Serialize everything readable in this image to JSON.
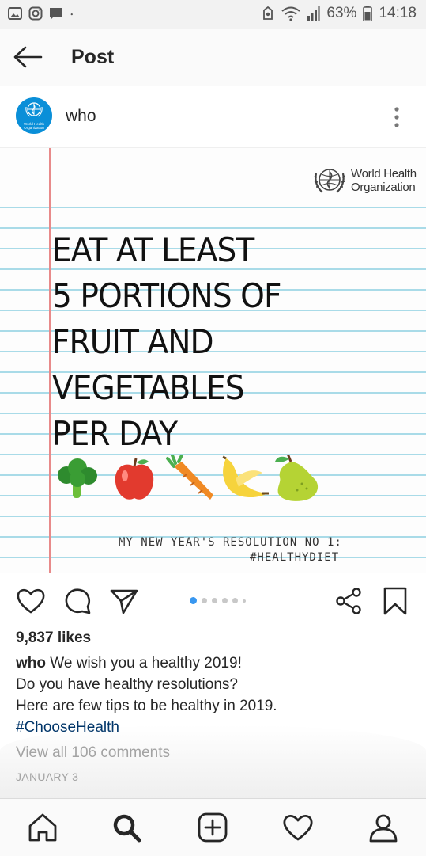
{
  "status_bar": {
    "battery_percent": "63%",
    "time": "14:18",
    "left_icons": [
      "gallery-icon",
      "instagram-icon",
      "message-icon",
      "dot-icon"
    ],
    "right_icons": [
      "notification-icon",
      "wifi-icon",
      "signal-icon",
      "battery-icon"
    ]
  },
  "header": {
    "title": "Post"
  },
  "post": {
    "username": "who",
    "avatar_text": "World Health Organization",
    "image": {
      "logo_line1": "World Health",
      "logo_line2": "Organization",
      "headline": [
        "EAT AT LEAST",
        "5 PORTIONS OF",
        "FRUIT AND",
        "VEGETABLES",
        "PER DAY"
      ],
      "foods": [
        "broccoli-icon",
        "apple-icon",
        "carrot-icon",
        "banana-icon",
        "pear-icon"
      ],
      "resolution_line1": "MY NEW YEAR'S RESOLUTION NO 1:",
      "resolution_line2": "#HEALTHYDIET"
    },
    "carousel": {
      "count": 6,
      "active_index": 0
    },
    "likes": "9,837 likes",
    "caption_user": "who",
    "caption_line1": "We wish you a healthy 2019!",
    "caption_line2": "Do you have healthy resolutions?",
    "caption_line3": "Here are few tips to be healthy in 2019.",
    "hashtag": "#ChooseHealth",
    "view_comments": "View all 106 comments",
    "date": "JANUARY 3"
  },
  "bottom_nav": [
    "home-icon",
    "search-icon",
    "add-post-icon",
    "activity-heart-icon",
    "profile-icon"
  ],
  "colors": {
    "accent": "#3897f0",
    "rule_line": "#a9dbe8",
    "margin_line": "#e88a8a",
    "who_blue": "#0a8fd8"
  }
}
